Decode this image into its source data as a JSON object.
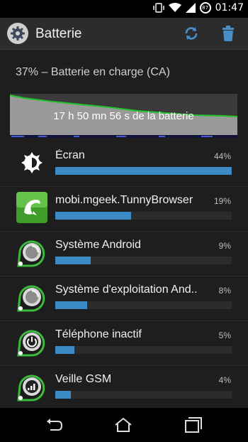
{
  "status_bar": {
    "time": "01:47",
    "battery_level": "87"
  },
  "app_bar": {
    "title": "Batterie",
    "refresh_icon": "refresh-icon",
    "delete_icon": "trash-icon"
  },
  "summary": "37% – Batterie en charge (CA)",
  "graph": {
    "label": "17 h 50 mn 56 s de la batterie",
    "line_color": "#22c32e",
    "fill_color": "#999999"
  },
  "items": [
    {
      "name": "Écran",
      "percent": "44%",
      "fraction": 1.0,
      "icon": "brightness-icon"
    },
    {
      "name": "mobi.mgeek.TunnyBrowser",
      "percent": "19%",
      "fraction": 0.43,
      "icon": "dolphin-browser-icon"
    },
    {
      "name": "Système Android",
      "percent": "9%",
      "fraction": 0.2,
      "icon": "android-system-icon"
    },
    {
      "name": "Système d'exploitation And..",
      "percent": "8%",
      "fraction": 0.18,
      "icon": "android-os-icon"
    },
    {
      "name": "Téléphone inactif",
      "percent": "5%",
      "fraction": 0.11,
      "icon": "power-icon"
    },
    {
      "name": "Veille GSM",
      "percent": "4%",
      "fraction": 0.09,
      "icon": "signal-icon"
    }
  ],
  "colors": {
    "accent": "#3b8ac6",
    "app_bar": "#2c2c2c",
    "background": "#1e1e1e"
  },
  "nav": {
    "back": "back-icon",
    "home": "home-icon",
    "recents": "recents-icon"
  }
}
